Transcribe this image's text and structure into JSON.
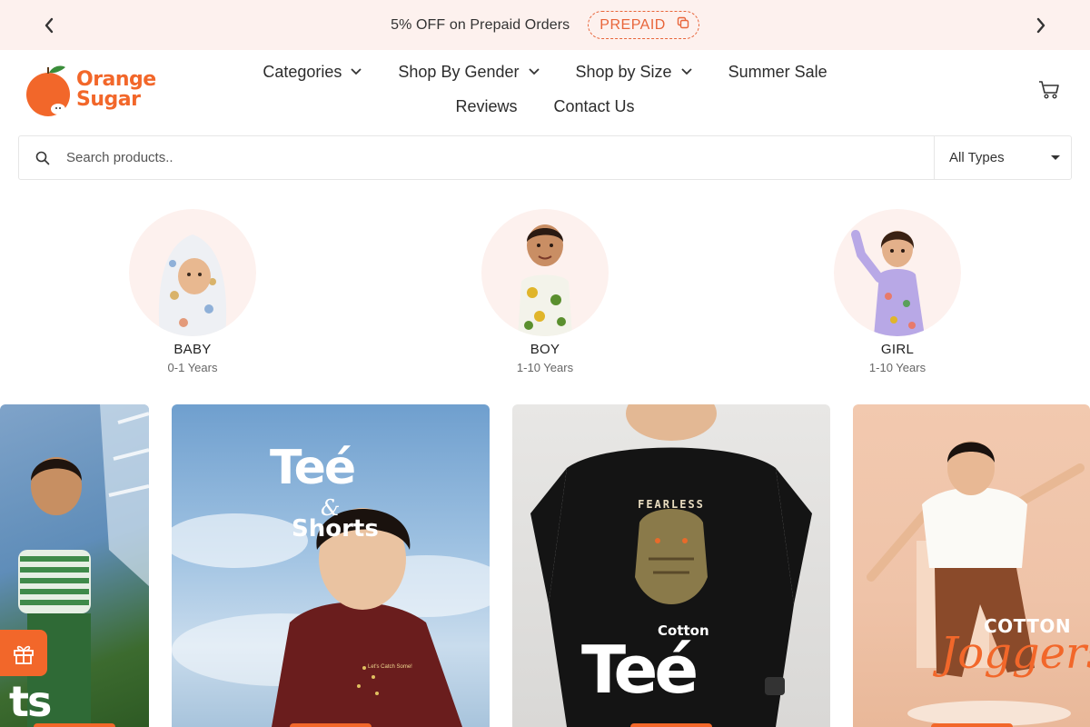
{
  "announcement": {
    "message": "5% OFF on Prepaid Orders",
    "code": "PREPAID",
    "prev_icon": "chevron-left-icon",
    "next_icon": "chevron-right-icon",
    "copy_icon": "copy-icon"
  },
  "brand": {
    "line1": "Orange",
    "line2": "Sugar",
    "color": "#f2672a"
  },
  "nav": {
    "row1": [
      {
        "label": "Categories",
        "dropdown": true
      },
      {
        "label": "Shop By Gender",
        "dropdown": true
      },
      {
        "label": "Shop by Size",
        "dropdown": true
      },
      {
        "label": "Summer Sale",
        "dropdown": false
      }
    ],
    "row2": [
      {
        "label": "Reviews"
      },
      {
        "label": "Contact Us"
      }
    ],
    "cart_icon": "cart-icon"
  },
  "search": {
    "placeholder": "Search products..",
    "type_selected": "All Types",
    "icon": "search-icon"
  },
  "categories": [
    {
      "name": "BABY",
      "age": "0-1 Years"
    },
    {
      "name": "BOY",
      "age": "1-10 Years"
    },
    {
      "name": "GIRL",
      "age": "1-10 Years"
    }
  ],
  "banners": {
    "b1": {
      "text": "ts"
    },
    "b2": {
      "line1": "Teé",
      "amp": "&",
      "line2": "Shorts",
      "shirt_text": "Let's Catch Some!"
    },
    "b3": {
      "shirt_text": "FEARLESS",
      "small": "Cotton",
      "big": "Teé"
    },
    "b4": {
      "small": "COTTON",
      "big": "Joggers"
    }
  },
  "gift_icon": "gift-icon",
  "colors": {
    "accent": "#f2672a",
    "announce_bg": "#fdf1ee",
    "circle_bg": "#fdf1ee"
  }
}
